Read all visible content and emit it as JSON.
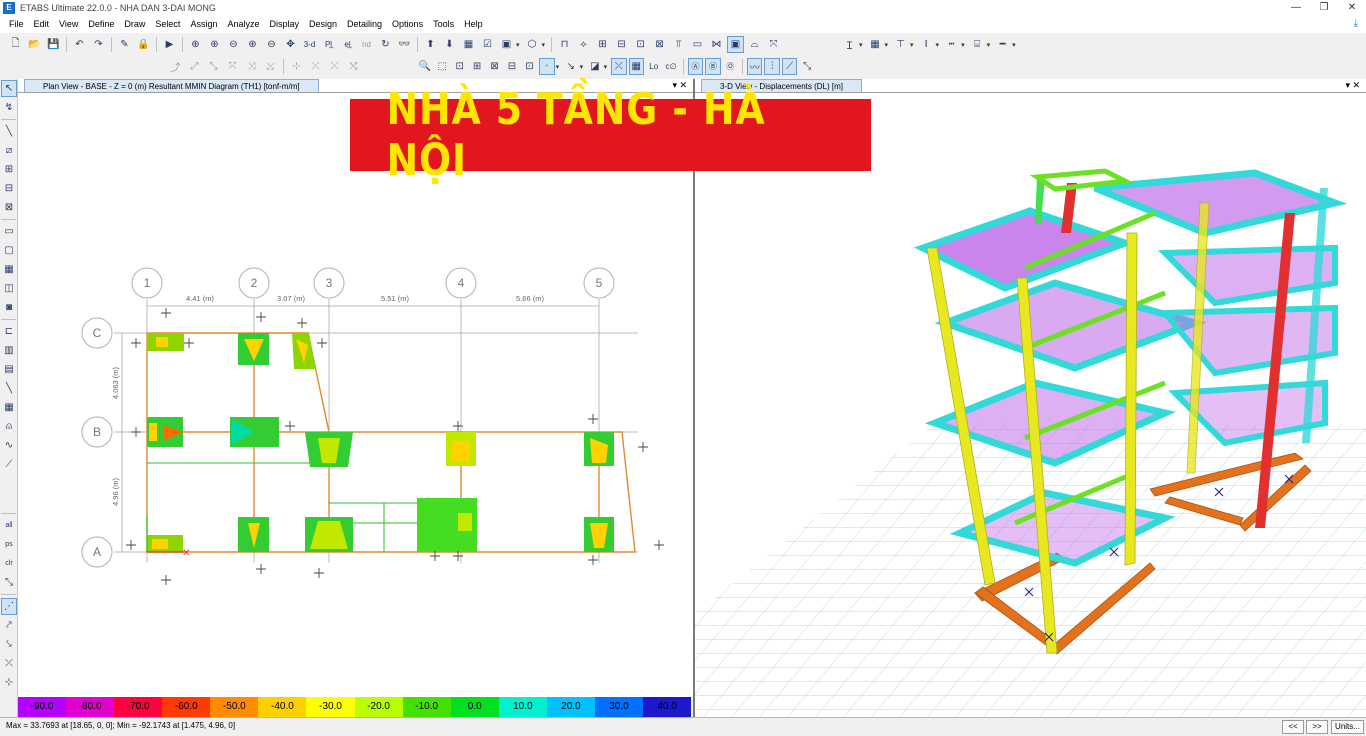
{
  "window": {
    "title": "ETABS Ultimate 22.0.0 - NHA DAN 3-DAI MONG",
    "logo": "E",
    "minimize": "—",
    "restore": "❐",
    "close": "✕"
  },
  "menu": [
    "File",
    "Edit",
    "View",
    "Define",
    "Draw",
    "Select",
    "Assign",
    "Analyze",
    "Display",
    "Design",
    "Detailing",
    "Options",
    "Tools",
    "Help"
  ],
  "toolbar1": {
    "buttons": [
      "new-file-icon",
      "open-icon",
      "save-icon",
      "undo-icon",
      "redo-icon",
      "pencil-icon",
      "lock-icon",
      "run-icon",
      "zoom-window-icon",
      "zoom-in-icon",
      "zoom-out-icon",
      "zoom-restore-icon",
      "zoom-prev-icon",
      "pan-icon",
      "view-3d",
      "view-plan",
      "view-elevation",
      "view-nd",
      "rotate-icon",
      "perspective-icon",
      "move-up-icon",
      "move-down-icon",
      "display-options-icon",
      "object-shrink-icon",
      "set-view-icon",
      "display-icon",
      "frame-icon",
      "link-icon",
      "stair-icon",
      "section-cut-icon",
      "wall-icon",
      "slab-icon",
      "deformed-icon",
      "reset-icon"
    ],
    "labels": {
      "view_3d": "3-d",
      "view_plan": "Pl̲",
      "view_elev": "el̲",
      "view_nd": "nd"
    },
    "right_icons": [
      "text-cursor-icon",
      "grid-icon",
      "filter-icon",
      "column-icon",
      "dashed-line-icon",
      "doc-icon",
      "line-icon"
    ]
  },
  "left_panel": {
    "tab_label": "Plan View - BASE - Z = 0 (m)    Resultant MMIN Diagram    (TH1)  [tonf-m/m]",
    "controls": "▾ ✕",
    "grid_x": [
      "1",
      "2",
      "3",
      "4",
      "5"
    ],
    "grid_y": [
      "C",
      "B",
      "A"
    ],
    "spans_x": [
      "4.41 (m)",
      "3.07 (m)",
      "5.51 (m)",
      "5.66 (m)"
    ],
    "spans_y": [
      "4.063 (m)",
      "4.96 (m)"
    ]
  },
  "right_panel": {
    "tab_label": "3-D View   - Displacements (DL)  [m]",
    "controls": "▾ ✕"
  },
  "banner": {
    "text": "NHÀ 5 TẦNG - HÀ NỘI",
    "bg": "#e2161f",
    "fg": "#ffe600"
  },
  "legend": {
    "labels": [
      "-90.0",
      "-80.0",
      "-70.0",
      "-60.0",
      "-50.0",
      "-40.0",
      "-30.0",
      "-20.0",
      "-10.0",
      "0.0",
      "10.0",
      "20.0",
      "30.0",
      "40.0"
    ],
    "colors": [
      "#b400ff",
      "#e000d0",
      "#ff0040",
      "#ff3a00",
      "#ff8c00",
      "#ffd000",
      "#ffff00",
      "#b8ff00",
      "#44e000",
      "#00e020",
      "#00f0d0",
      "#00c0ff",
      "#0070ff",
      "#1a1acc"
    ]
  },
  "status": {
    "text": "Max = 33.7693 at [18.65, 0, 0];  Min = -92.1743 at [1.475, 4.96, 0]",
    "prev": "<<",
    "next": ">>",
    "units": "Units..."
  }
}
